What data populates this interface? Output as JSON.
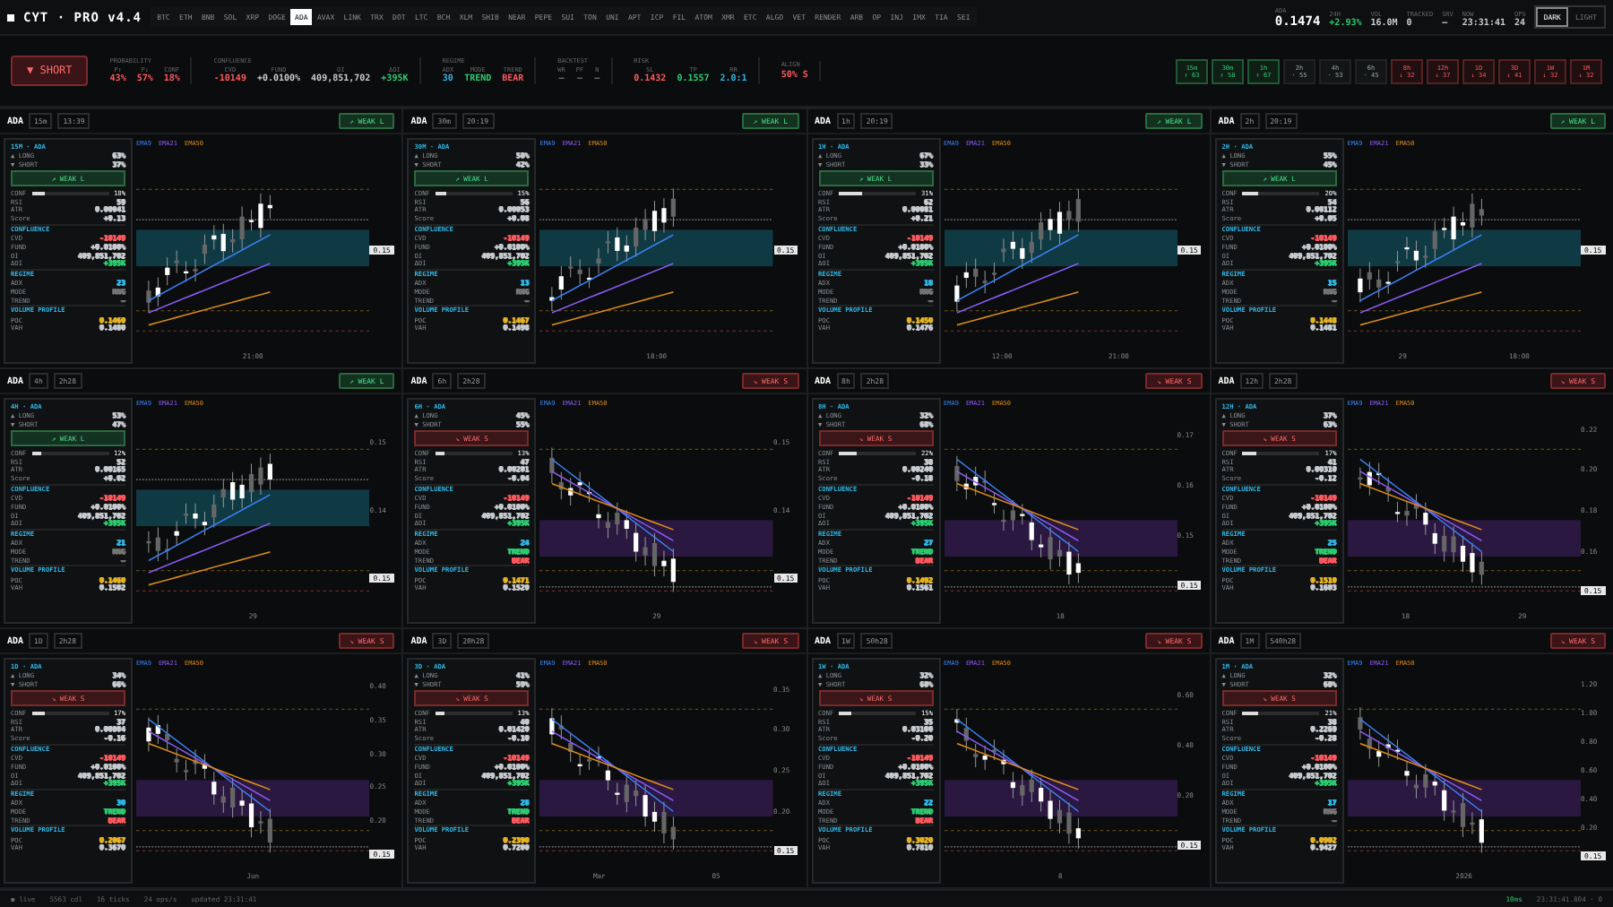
{
  "brand": {
    "title": "CYT · PRO v4.4"
  },
  "tickers": [
    {
      "label": "BTC",
      "selected": false
    },
    {
      "label": "ETH",
      "selected": false
    },
    {
      "label": "BNB",
      "selected": false
    },
    {
      "label": "SOL",
      "selected": false
    },
    {
      "label": "XRP",
      "selected": false
    },
    {
      "label": "DOGE",
      "selected": false
    },
    {
      "label": "ADA",
      "selected": true
    },
    {
      "label": "AVAX",
      "selected": false
    },
    {
      "label": "LINK",
      "selected": false
    },
    {
      "label": "TRX",
      "selected": false
    },
    {
      "label": "DOT",
      "selected": false
    },
    {
      "label": "LTC",
      "selected": false
    },
    {
      "label": "BCH",
      "selected": false
    },
    {
      "label": "XLM",
      "selected": false
    },
    {
      "label": "SHIB",
      "selected": false
    },
    {
      "label": "NEAR",
      "selected": false
    },
    {
      "label": "PEPE",
      "selected": false
    },
    {
      "label": "SUI",
      "selected": false
    },
    {
      "label": "TON",
      "selected": false
    },
    {
      "label": "UNI",
      "selected": false
    },
    {
      "label": "APT",
      "selected": false
    },
    {
      "label": "ICP",
      "selected": false
    },
    {
      "label": "FIL",
      "selected": false
    },
    {
      "label": "ATOM",
      "selected": false
    },
    {
      "label": "XMR",
      "selected": false
    },
    {
      "label": "ETC",
      "selected": false
    },
    {
      "label": "ALGO",
      "selected": false
    },
    {
      "label": "VET",
      "selected": false
    },
    {
      "label": "RENDER",
      "selected": false
    },
    {
      "label": "ARB",
      "selected": false
    },
    {
      "label": "OP",
      "selected": false
    },
    {
      "label": "INJ",
      "selected": false
    },
    {
      "label": "IMX",
      "selected": false
    },
    {
      "label": "TIA",
      "selected": false
    },
    {
      "label": "SEI",
      "selected": false
    }
  ],
  "header_stats": [
    {
      "label": "ADA",
      "value": "0.1474",
      "kind": "price"
    },
    {
      "label": "24H",
      "value": "+2.93%",
      "kind": "up"
    },
    {
      "label": "VOL",
      "value": "16.0M",
      "kind": "plain"
    },
    {
      "label": "TRACKED",
      "value": "0",
      "kind": "plain"
    },
    {
      "label": "SRV",
      "value": "—",
      "kind": "plain"
    },
    {
      "label": "NOW",
      "value": "23:31:41",
      "kind": "plain"
    },
    {
      "label": "OPS",
      "value": "24",
      "kind": "plain"
    }
  ],
  "theme_toggle": [
    {
      "label": "DARK",
      "selected": true
    },
    {
      "label": "LIGHT",
      "selected": false
    }
  ],
  "signal_button": {
    "label": "▼ SHORT"
  },
  "summary_groups": [
    {
      "title": "PROBABILITY",
      "items": [
        {
          "label": "P↑",
          "value": "43%",
          "kind": "down"
        },
        {
          "label": "P↓",
          "value": "57%",
          "kind": "down"
        },
        {
          "label": "CONF",
          "value": "18%",
          "kind": "down"
        }
      ]
    },
    {
      "title": "CONFLUENCE",
      "items": [
        {
          "label": "CVD",
          "value": "-10149",
          "kind": "down"
        },
        {
          "label": "FUND",
          "value": "+0.0100%",
          "kind": "plain"
        },
        {
          "label": "OI",
          "value": "409,851,702",
          "kind": "plain"
        },
        {
          "label": "ΔOI",
          "value": "+395K",
          "kind": "up"
        }
      ]
    },
    {
      "title": "REGIME",
      "items": [
        {
          "label": "ADX",
          "value": "30",
          "kind": "info"
        },
        {
          "label": "MODE",
          "value": "TREND",
          "kind": "up"
        },
        {
          "label": "TREND",
          "value": "BEAR",
          "kind": "down"
        }
      ]
    },
    {
      "title": "BACKTEST",
      "items": [
        {
          "label": "WR",
          "value": "—",
          "kind": "muted"
        },
        {
          "label": "PF",
          "value": "—",
          "kind": "muted"
        },
        {
          "label": "N",
          "value": "—",
          "kind": "muted"
        }
      ]
    },
    {
      "title": "RISK",
      "items": [
        {
          "label": "SL",
          "value": "0.1432",
          "kind": "down"
        },
        {
          "label": "TP",
          "value": "0.1557",
          "kind": "up"
        },
        {
          "label": "RR",
          "value": "2.0:1",
          "kind": "info"
        }
      ]
    },
    {
      "title": "ALIGN",
      "items": [
        {
          "value": "50% S",
          "kind": "down"
        }
      ]
    }
  ],
  "timeframe_chips": [
    {
      "tf": "15m",
      "value": "↑ 63",
      "kind": "up"
    },
    {
      "tf": "30m",
      "value": "↑ 58",
      "kind": "up"
    },
    {
      "tf": "1h",
      "value": "↑ 67",
      "kind": "up"
    },
    {
      "tf": "2h",
      "value": "· 55",
      "kind": "flat"
    },
    {
      "tf": "4h",
      "value": "· 53",
      "kind": "flat"
    },
    {
      "tf": "6h",
      "value": "· 45",
      "kind": "flat"
    },
    {
      "tf": "8h",
      "value": "↓ 32",
      "kind": "down"
    },
    {
      "tf": "12h",
      "value": "↓ 37",
      "kind": "down"
    },
    {
      "tf": "1D",
      "value": "↓ 34",
      "kind": "down"
    },
    {
      "tf": "3D",
      "value": "↓ 41",
      "kind": "down"
    },
    {
      "tf": "1W",
      "value": "↓ 32",
      "kind": "down"
    },
    {
      "tf": "1M",
      "value": "↓ 32",
      "kind": "down"
    }
  ],
  "panels": [
    {
      "symbol": "ADA",
      "tf": "15m",
      "time": "13:39",
      "signal": "↗ WEAK L",
      "bullish": true,
      "legend": [
        "EMA9",
        "EMA21",
        "EMA50"
      ],
      "price_tag": "0.15",
      "x_labels": [
        "21:00"
      ],
      "card": [
        {
          "kind": "title",
          "text": "15M · ADA"
        },
        {
          "kind": "row",
          "label": "▲ LONG",
          "value": "63%"
        },
        {
          "kind": "row",
          "label": "▼ SHORT",
          "value": "37%"
        },
        {
          "kind": "signal",
          "text": "↗ WEAK L"
        },
        {
          "kind": "meter",
          "label": "CONF",
          "value": "18%",
          "level": 0.18
        },
        {
          "kind": "row",
          "label": "RSI",
          "value": "59"
        },
        {
          "kind": "row",
          "label": "ATR",
          "value": "0.00041"
        },
        {
          "kind": "row",
          "label": "Score",
          "value": "+0.13"
        },
        {
          "kind": "section",
          "text": "CONFLUENCE"
        },
        {
          "kind": "row",
          "label": "CVD",
          "value": "-10149",
          "color": "#ff5a5f"
        },
        {
          "kind": "row",
          "label": "FUND",
          "value": "+0.0100%"
        },
        {
          "kind": "row",
          "label": "OI",
          "value": "409,851,702"
        },
        {
          "kind": "row",
          "label": "ΔOI",
          "value": "+395K",
          "color": "#2ecc71"
        },
        {
          "kind": "section",
          "text": "REGIME"
        },
        {
          "kind": "row",
          "label": "ADX",
          "value": "23",
          "color": "#31b6e6"
        },
        {
          "kind": "row",
          "label": "MODE",
          "value": "RNG",
          "color": "#777777"
        },
        {
          "kind": "row",
          "label": "TREND",
          "value": "—",
          "color": "#777777"
        },
        {
          "kind": "section",
          "text": "VOLUME PROFILE"
        },
        {
          "kind": "row",
          "label": "POC",
          "value": "0.1460",
          "color": "#e6b422"
        },
        {
          "kind": "row",
          "label": "VAH",
          "value": "0.1480"
        }
      ]
    },
    {
      "symbol": "ADA",
      "tf": "30m",
      "time": "20:19",
      "signal": "↗ WEAK L",
      "bullish": true,
      "legend": [
        "EMA9",
        "EMA21",
        "EMA50"
      ],
      "price_tag": "0.15",
      "x_labels": [
        "18:00"
      ],
      "card": [
        {
          "kind": "title",
          "text": "30M · ADA"
        },
        {
          "kind": "row",
          "label": "▲ LONG",
          "value": "58%"
        },
        {
          "kind": "row",
          "label": "▼ SHORT",
          "value": "42%"
        },
        {
          "kind": "signal",
          "text": "↗ WEAK L"
        },
        {
          "kind": "meter",
          "label": "CONF",
          "value": "15%",
          "level": 0.15
        },
        {
          "kind": "row",
          "label": "RSI",
          "value": "56"
        },
        {
          "kind": "row",
          "label": "ATR",
          "value": "0.00053"
        },
        {
          "kind": "row",
          "label": "Score",
          "value": "+0.08"
        },
        {
          "kind": "section",
          "text": "CONFLUENCE"
        },
        {
          "kind": "row",
          "label": "CVD",
          "value": "-10149",
          "color": "#ff5a5f"
        },
        {
          "kind": "row",
          "label": "FUND",
          "value": "+0.0100%"
        },
        {
          "kind": "row",
          "label": "OI",
          "value": "409,851,702"
        },
        {
          "kind": "row",
          "label": "ΔOI",
          "value": "+395K",
          "color": "#2ecc71"
        },
        {
          "kind": "section",
          "text": "REGIME"
        },
        {
          "kind": "row",
          "label": "ADX",
          "value": "13",
          "color": "#31b6e6"
        },
        {
          "kind": "row",
          "label": "MODE",
          "value": "RNG",
          "color": "#777777"
        },
        {
          "kind": "row",
          "label": "TREND",
          "value": "—",
          "color": "#777777"
        },
        {
          "kind": "section",
          "text": "VOLUME PROFILE"
        },
        {
          "kind": "row",
          "label": "POC",
          "value": "0.1467",
          "color": "#e6b422"
        },
        {
          "kind": "row",
          "label": "VAH",
          "value": "0.1498"
        }
      ]
    },
    {
      "symbol": "ADA",
      "tf": "1h",
      "time": "20:19",
      "signal": "↗ WEAK L",
      "bullish": true,
      "legend": [
        "EMA9",
        "EMA21",
        "EMA50"
      ],
      "price_tag": "0.15",
      "x_labels": [
        "12:00",
        "21:00"
      ],
      "card": [
        {
          "kind": "title",
          "text": "1H · ADA"
        },
        {
          "kind": "row",
          "label": "▲ LONG",
          "value": "67%"
        },
        {
          "kind": "row",
          "label": "▼ SHORT",
          "value": "33%"
        },
        {
          "kind": "signal",
          "text": "↗ WEAK L"
        },
        {
          "kind": "meter",
          "label": "CONF",
          "value": "31%",
          "level": 0.31
        },
        {
          "kind": "row",
          "label": "RSI",
          "value": "62"
        },
        {
          "kind": "row",
          "label": "ATR",
          "value": "0.00081"
        },
        {
          "kind": "row",
          "label": "Score",
          "value": "+0.21"
        },
        {
          "kind": "section",
          "text": "CONFLUENCE"
        },
        {
          "kind": "row",
          "label": "CVD",
          "value": "-10149",
          "color": "#ff5a5f"
        },
        {
          "kind": "row",
          "label": "FUND",
          "value": "+0.0100%"
        },
        {
          "kind": "row",
          "label": "OI",
          "value": "409,851,702"
        },
        {
          "kind": "row",
          "label": "ΔOI",
          "value": "+395K",
          "color": "#2ecc71"
        },
        {
          "kind": "section",
          "text": "REGIME"
        },
        {
          "kind": "row",
          "label": "ADX",
          "value": "18",
          "color": "#31b6e6"
        },
        {
          "kind": "row",
          "label": "MODE",
          "value": "RNG",
          "color": "#777777"
        },
        {
          "kind": "row",
          "label": "TREND",
          "value": "—",
          "color": "#777777"
        },
        {
          "kind": "section",
          "text": "VOLUME PROFILE"
        },
        {
          "kind": "row",
          "label": "POC",
          "value": "0.1450",
          "color": "#e6b422"
        },
        {
          "kind": "row",
          "label": "VAH",
          "value": "0.1476"
        }
      ]
    },
    {
      "symbol": "ADA",
      "tf": "2h",
      "time": "20:19",
      "signal": "↗ WEAK L",
      "bullish": true,
      "legend": [
        "EMA9",
        "EMA21",
        "EMA50"
      ],
      "price_tag": "0.15",
      "x_labels": [
        "29",
        "18:00"
      ],
      "card": [
        {
          "kind": "title",
          "text": "2H · ADA"
        },
        {
          "kind": "row",
          "label": "▲ LONG",
          "value": "55%"
        },
        {
          "kind": "row",
          "label": "▼ SHORT",
          "value": "45%"
        },
        {
          "kind": "signal",
          "text": "↗ WEAK L"
        },
        {
          "kind": "meter",
          "label": "CONF",
          "value": "20%",
          "level": 0.2
        },
        {
          "kind": "row",
          "label": "RSI",
          "value": "54"
        },
        {
          "kind": "row",
          "label": "ATR",
          "value": "0.00112"
        },
        {
          "kind": "row",
          "label": "Score",
          "value": "+0.05"
        },
        {
          "kind": "section",
          "text": "CONFLUENCE"
        },
        {
          "kind": "row",
          "label": "CVD",
          "value": "-10149",
          "color": "#ff5a5f"
        },
        {
          "kind": "row",
          "label": "FUND",
          "value": "+0.0100%"
        },
        {
          "kind": "row",
          "label": "OI",
          "value": "409,851,702"
        },
        {
          "kind": "row",
          "label": "ΔOI",
          "value": "+395K",
          "color": "#2ecc71"
        },
        {
          "kind": "section",
          "text": "REGIME"
        },
        {
          "kind": "row",
          "label": "ADX",
          "value": "15",
          "color": "#31b6e6"
        },
        {
          "kind": "row",
          "label": "MODE",
          "value": "RNG",
          "color": "#777777"
        },
        {
          "kind": "row",
          "label": "TREND",
          "value": "—",
          "color": "#777777"
        },
        {
          "kind": "section",
          "text": "VOLUME PROFILE"
        },
        {
          "kind": "row",
          "label": "POC",
          "value": "0.1448",
          "color": "#e6b422"
        },
        {
          "kind": "row",
          "label": "VAH",
          "value": "0.1481"
        }
      ]
    },
    {
      "symbol": "ADA",
      "tf": "4h",
      "time": "2h28",
      "signal": "↗ WEAK L",
      "bullish": true,
      "legend": [
        "EMA9",
        "EMA21",
        "EMA50"
      ],
      "price_tag": "0.15",
      "x_labels": [
        "29"
      ],
      "y_labels": [
        "0.15",
        "0.14"
      ],
      "card": [
        {
          "kind": "title",
          "text": "4H · ADA"
        },
        {
          "kind": "row",
          "label": "▲ LONG",
          "value": "53%"
        },
        {
          "kind": "row",
          "label": "▼ SHORT",
          "value": "47%"
        },
        {
          "kind": "signal",
          "text": "↗ WEAK L"
        },
        {
          "kind": "meter",
          "label": "CONF",
          "value": "12%",
          "level": 0.12
        },
        {
          "kind": "row",
          "label": "RSI",
          "value": "52"
        },
        {
          "kind": "row",
          "label": "ATR",
          "value": "0.00165"
        },
        {
          "kind": "row",
          "label": "Score",
          "value": "+0.02"
        },
        {
          "kind": "section",
          "text": "CONFLUENCE"
        },
        {
          "kind": "row",
          "label": "CVD",
          "value": "-10149",
          "color": "#ff5a5f"
        },
        {
          "kind": "row",
          "label": "FUND",
          "value": "+0.0100%"
        },
        {
          "kind": "row",
          "label": "OI",
          "value": "409,851,702"
        },
        {
          "kind": "row",
          "label": "ΔOI",
          "value": "+395K",
          "color": "#2ecc71"
        },
        {
          "kind": "section",
          "text": "REGIME"
        },
        {
          "kind": "row",
          "label": "ADX",
          "value": "21",
          "color": "#31b6e6"
        },
        {
          "kind": "row",
          "label": "MODE",
          "value": "RNG",
          "color": "#777777"
        },
        {
          "kind": "row",
          "label": "TREND",
          "value": "—",
          "color": "#777777"
        },
        {
          "kind": "section",
          "text": "VOLUME PROFILE"
        },
        {
          "kind": "row",
          "label": "POC",
          "value": "0.1460",
          "color": "#e6b422"
        },
        {
          "kind": "row",
          "label": "VAH",
          "value": "0.1502"
        }
      ]
    },
    {
      "symbol": "ADA",
      "tf": "6h",
      "time": "2h28",
      "signal": "↘ WEAK S",
      "bullish": false,
      "legend": [
        "EMA9",
        "EMA21",
        "EMA50"
      ],
      "price_tag": "0.15",
      "x_labels": [
        "29"
      ],
      "y_labels": [
        "0.15",
        "0.14"
      ],
      "card": [
        {
          "kind": "title",
          "text": "6H · ADA"
        },
        {
          "kind": "row",
          "label": "▲ LONG",
          "value": "45%"
        },
        {
          "kind": "row",
          "label": "▼ SHORT",
          "value": "55%"
        },
        {
          "kind": "signal",
          "text": "↘ WEAK S"
        },
        {
          "kind": "meter",
          "label": "CONF",
          "value": "13%",
          "level": 0.13
        },
        {
          "kind": "row",
          "label": "RSI",
          "value": "47"
        },
        {
          "kind": "row",
          "label": "ATR",
          "value": "0.00201"
        },
        {
          "kind": "row",
          "label": "Score",
          "value": "-0.04"
        },
        {
          "kind": "section",
          "text": "CONFLUENCE"
        },
        {
          "kind": "row",
          "label": "CVD",
          "value": "-10149",
          "color": "#ff5a5f"
        },
        {
          "kind": "row",
          "label": "FUND",
          "value": "+0.0100%"
        },
        {
          "kind": "row",
          "label": "OI",
          "value": "409,851,702"
        },
        {
          "kind": "row",
          "label": "ΔOI",
          "value": "+395K",
          "color": "#2ecc71"
        },
        {
          "kind": "section",
          "text": "REGIME"
        },
        {
          "kind": "row",
          "label": "ADX",
          "value": "24",
          "color": "#31b6e6"
        },
        {
          "kind": "row",
          "label": "MODE",
          "value": "TREND",
          "color": "#2ecc71"
        },
        {
          "kind": "row",
          "label": "TREND",
          "value": "BEAR",
          "color": "#ff5a5f"
        },
        {
          "kind": "section",
          "text": "VOLUME PROFILE"
        },
        {
          "kind": "row",
          "label": "POC",
          "value": "0.1471",
          "color": "#e6b422"
        },
        {
          "kind": "row",
          "label": "VAH",
          "value": "0.1520"
        }
      ]
    },
    {
      "symbol": "ADA",
      "tf": "8h",
      "time": "2h28",
      "signal": "↘ WEAK S",
      "bullish": false,
      "legend": [
        "EMA9",
        "EMA21",
        "EMA50"
      ],
      "price_tag": "0.15",
      "x_labels": [
        "18"
      ],
      "y_labels": [
        "0.17",
        "0.16",
        "0.15"
      ],
      "card": [
        {
          "kind": "title",
          "text": "8H · ADA"
        },
        {
          "kind": "row",
          "label": "▲ LONG",
          "value": "32%"
        },
        {
          "kind": "row",
          "label": "▼ SHORT",
          "value": "68%"
        },
        {
          "kind": "signal",
          "text": "↘ WEAK S"
        },
        {
          "kind": "meter",
          "label": "CONF",
          "value": "22%",
          "level": 0.22
        },
        {
          "kind": "row",
          "label": "RSI",
          "value": "38"
        },
        {
          "kind": "row",
          "label": "ATR",
          "value": "0.00240"
        },
        {
          "kind": "row",
          "label": "Score",
          "value": "-0.18"
        },
        {
          "kind": "section",
          "text": "CONFLUENCE"
        },
        {
          "kind": "row",
          "label": "CVD",
          "value": "-10149",
          "color": "#ff5a5f"
        },
        {
          "kind": "row",
          "label": "FUND",
          "value": "+0.0100%"
        },
        {
          "kind": "row",
          "label": "OI",
          "value": "409,851,702"
        },
        {
          "kind": "row",
          "label": "ΔOI",
          "value": "+395K",
          "color": "#2ecc71"
        },
        {
          "kind": "section",
          "text": "REGIME"
        },
        {
          "kind": "row",
          "label": "ADX",
          "value": "27",
          "color": "#31b6e6"
        },
        {
          "kind": "row",
          "label": "MODE",
          "value": "TREND",
          "color": "#2ecc71"
        },
        {
          "kind": "row",
          "label": "TREND",
          "value": "BEAR",
          "color": "#ff5a5f"
        },
        {
          "kind": "section",
          "text": "VOLUME PROFILE"
        },
        {
          "kind": "row",
          "label": "POC",
          "value": "0.1492",
          "color": "#e6b422"
        },
        {
          "kind": "row",
          "label": "VAH",
          "value": "0.1561"
        }
      ]
    },
    {
      "symbol": "ADA",
      "tf": "12h",
      "time": "2h28",
      "signal": "↘ WEAK S",
      "bullish": false,
      "legend": [
        "EMA9",
        "EMA21",
        "EMA50"
      ],
      "price_tag": "0.15",
      "x_labels": [
        "18",
        "29"
      ],
      "y_labels": [
        "0.22",
        "0.20",
        "0.18",
        "0.16"
      ],
      "card": [
        {
          "kind": "title",
          "text": "12H · ADA"
        },
        {
          "kind": "row",
          "label": "▲ LONG",
          "value": "37%"
        },
        {
          "kind": "row",
          "label": "▼ SHORT",
          "value": "63%"
        },
        {
          "kind": "signal",
          "text": "↘ WEAK S"
        },
        {
          "kind": "meter",
          "label": "CONF",
          "value": "17%",
          "level": 0.17
        },
        {
          "kind": "row",
          "label": "RSI",
          "value": "41"
        },
        {
          "kind": "row",
          "label": "ATR",
          "value": "0.00310"
        },
        {
          "kind": "row",
          "label": "Score",
          "value": "-0.12"
        },
        {
          "kind": "section",
          "text": "CONFLUENCE"
        },
        {
          "kind": "row",
          "label": "CVD",
          "value": "-10149",
          "color": "#ff5a5f"
        },
        {
          "kind": "row",
          "label": "FUND",
          "value": "+0.0100%"
        },
        {
          "kind": "row",
          "label": "OI",
          "value": "409,851,702"
        },
        {
          "kind": "row",
          "label": "ΔOI",
          "value": "+395K",
          "color": "#2ecc71"
        },
        {
          "kind": "section",
          "text": "REGIME"
        },
        {
          "kind": "row",
          "label": "ADX",
          "value": "25",
          "color": "#31b6e6"
        },
        {
          "kind": "row",
          "label": "MODE",
          "value": "TREND",
          "color": "#2ecc71"
        },
        {
          "kind": "row",
          "label": "TREND",
          "value": "BEAR",
          "color": "#ff5a5f"
        },
        {
          "kind": "section",
          "text": "VOLUME PROFILE"
        },
        {
          "kind": "row",
          "label": "POC",
          "value": "0.1510",
          "color": "#e6b422"
        },
        {
          "kind": "row",
          "label": "VAH",
          "value": "0.1603"
        }
      ]
    },
    {
      "symbol": "ADA",
      "tf": "1D",
      "time": "2h28",
      "signal": "↘ WEAK S",
      "bullish": false,
      "legend": [
        "EMA9",
        "EMA21",
        "EMA50"
      ],
      "price_tag": "0.15",
      "x_labels": [
        "Jun"
      ],
      "y_labels": [
        "0.40",
        "0.35",
        "0.30",
        "0.25",
        "0.20"
      ],
      "card": [
        {
          "kind": "title",
          "text": "1D · ADA"
        },
        {
          "kind": "row",
          "label": "▲ LONG",
          "value": "34%"
        },
        {
          "kind": "row",
          "label": "▼ SHORT",
          "value": "66%"
        },
        {
          "kind": "signal",
          "text": "↘ WEAK S"
        },
        {
          "kind": "meter",
          "label": "CONF",
          "value": "17%",
          "level": 0.17
        },
        {
          "kind": "row",
          "label": "RSI",
          "value": "37"
        },
        {
          "kind": "row",
          "label": "ATR",
          "value": "0.00804"
        },
        {
          "kind": "row",
          "label": "Score",
          "value": "-0.16"
        },
        {
          "kind": "section",
          "text": "CONFLUENCE"
        },
        {
          "kind": "row",
          "label": "CVD",
          "value": "-10149",
          "color": "#ff5a5f"
        },
        {
          "kind": "row",
          "label": "FUND",
          "value": "+0.0100%"
        },
        {
          "kind": "row",
          "label": "OI",
          "value": "409,851,702"
        },
        {
          "kind": "row",
          "label": "ΔOI",
          "value": "+395K",
          "color": "#2ecc71"
        },
        {
          "kind": "section",
          "text": "REGIME"
        },
        {
          "kind": "row",
          "label": "ADX",
          "value": "30",
          "color": "#31b6e6"
        },
        {
          "kind": "row",
          "label": "MODE",
          "value": "TREND",
          "color": "#2ecc71"
        },
        {
          "kind": "row",
          "label": "TREND",
          "value": "BEAR",
          "color": "#ff5a5f"
        },
        {
          "kind": "section",
          "text": "VOLUME PROFILE"
        },
        {
          "kind": "row",
          "label": "POC",
          "value": "0.2067",
          "color": "#e6b422"
        },
        {
          "kind": "row",
          "label": "VAH",
          "value": "0.3670"
        }
      ]
    },
    {
      "symbol": "ADA",
      "tf": "3D",
      "time": "20h28",
      "signal": "↘ WEAK S",
      "bullish": false,
      "legend": [
        "EMA9",
        "EMA21",
        "EMA50"
      ],
      "price_tag": "0.15",
      "x_labels": [
        "Mar",
        "05"
      ],
      "y_labels": [
        "0.35",
        "0.30",
        "0.25",
        "0.20"
      ],
      "card": [
        {
          "kind": "title",
          "text": "3D · ADA"
        },
        {
          "kind": "row",
          "label": "▲ LONG",
          "value": "41%"
        },
        {
          "kind": "row",
          "label": "▼ SHORT",
          "value": "59%"
        },
        {
          "kind": "signal",
          "text": "↘ WEAK S"
        },
        {
          "kind": "meter",
          "label": "CONF",
          "value": "13%",
          "level": 0.13
        },
        {
          "kind": "row",
          "label": "RSI",
          "value": "40"
        },
        {
          "kind": "row",
          "label": "ATR",
          "value": "0.01420"
        },
        {
          "kind": "row",
          "label": "Score",
          "value": "-0.10"
        },
        {
          "kind": "section",
          "text": "CONFLUENCE"
        },
        {
          "kind": "row",
          "label": "CVD",
          "value": "-10149",
          "color": "#ff5a5f"
        },
        {
          "kind": "row",
          "label": "FUND",
          "value": "+0.0100%"
        },
        {
          "kind": "row",
          "label": "OI",
          "value": "409,851,702"
        },
        {
          "kind": "row",
          "label": "ΔOI",
          "value": "+395K",
          "color": "#2ecc71"
        },
        {
          "kind": "section",
          "text": "REGIME"
        },
        {
          "kind": "row",
          "label": "ADX",
          "value": "28",
          "color": "#31b6e6"
        },
        {
          "kind": "row",
          "label": "MODE",
          "value": "TREND",
          "color": "#2ecc71"
        },
        {
          "kind": "row",
          "label": "TREND",
          "value": "BEAR",
          "color": "#ff5a5f"
        },
        {
          "kind": "section",
          "text": "VOLUME PROFILE"
        },
        {
          "kind": "row",
          "label": "POC",
          "value": "0.2390",
          "color": "#e6b422"
        },
        {
          "kind": "row",
          "label": "VAH",
          "value": "0.7200"
        }
      ]
    },
    {
      "symbol": "ADA",
      "tf": "1W",
      "time": "50h28",
      "signal": "↘ WEAK S",
      "bullish": false,
      "legend": [
        "EMA9",
        "EMA21",
        "EMA50"
      ],
      "price_tag": "0.15",
      "x_labels": [
        "8"
      ],
      "y_labels": [
        "0.60",
        "0.40",
        "0.20"
      ],
      "card": [
        {
          "kind": "title",
          "text": "1W · ADA"
        },
        {
          "kind": "row",
          "label": "▲ LONG",
          "value": "32%"
        },
        {
          "kind": "row",
          "label": "▼ SHORT",
          "value": "68%"
        },
        {
          "kind": "signal",
          "text": "↘ WEAK S"
        },
        {
          "kind": "meter",
          "label": "CONF",
          "value": "15%",
          "level": 0.15
        },
        {
          "kind": "row",
          "label": "RSI",
          "value": "35"
        },
        {
          "kind": "row",
          "label": "ATR",
          "value": "0.03100"
        },
        {
          "kind": "row",
          "label": "Score",
          "value": "-0.20"
        },
        {
          "kind": "section",
          "text": "CONFLUENCE"
        },
        {
          "kind": "row",
          "label": "CVD",
          "value": "-10149",
          "color": "#ff5a5f"
        },
        {
          "kind": "row",
          "label": "FUND",
          "value": "+0.0100%"
        },
        {
          "kind": "row",
          "label": "OI",
          "value": "409,851,702"
        },
        {
          "kind": "row",
          "label": "ΔOI",
          "value": "+395K",
          "color": "#2ecc71"
        },
        {
          "kind": "section",
          "text": "REGIME"
        },
        {
          "kind": "row",
          "label": "ADX",
          "value": "22",
          "color": "#31b6e6"
        },
        {
          "kind": "row",
          "label": "MODE",
          "value": "TREND",
          "color": "#2ecc71"
        },
        {
          "kind": "row",
          "label": "TREND",
          "value": "BEAR",
          "color": "#ff5a5f"
        },
        {
          "kind": "section",
          "text": "VOLUME PROFILE"
        },
        {
          "kind": "row",
          "label": "POC",
          "value": "0.3020",
          "color": "#e6b422"
        },
        {
          "kind": "row",
          "label": "VAH",
          "value": "0.7810"
        }
      ]
    },
    {
      "symbol": "ADA",
      "tf": "1M",
      "time": "540h28",
      "signal": "↘ WEAK S",
      "bullish": false,
      "legend": [
        "EMA9",
        "EMA21",
        "EMA50"
      ],
      "price_tag": "0.15",
      "x_labels": [
        "2026"
      ],
      "y_labels": [
        "1.20",
        "1.00",
        "0.80",
        "0.60",
        "0.40",
        "0.20"
      ],
      "card": [
        {
          "kind": "title",
          "text": "1M · ADA"
        },
        {
          "kind": "row",
          "label": "▲ LONG",
          "value": "32%"
        },
        {
          "kind": "row",
          "label": "▼ SHORT",
          "value": "68%"
        },
        {
          "kind": "signal",
          "text": "↘ WEAK S"
        },
        {
          "kind": "meter",
          "label": "CONF",
          "value": "21%",
          "level": 0.21
        },
        {
          "kind": "row",
          "label": "RSI",
          "value": "38"
        },
        {
          "kind": "row",
          "label": "ATR",
          "value": "0.2269"
        },
        {
          "kind": "row",
          "label": "Score",
          "value": "-0.28"
        },
        {
          "kind": "section",
          "text": "CONFLUENCE"
        },
        {
          "kind": "row",
          "label": "CVD",
          "value": "-10149",
          "color": "#ff5a5f"
        },
        {
          "kind": "row",
          "label": "FUND",
          "value": "+0.0100%"
        },
        {
          "kind": "row",
          "label": "OI",
          "value": "409,851,702"
        },
        {
          "kind": "row",
          "label": "ΔOI",
          "value": "+395K",
          "color": "#2ecc71"
        },
        {
          "kind": "section",
          "text": "REGIME"
        },
        {
          "kind": "row",
          "label": "ADX",
          "value": "17",
          "color": "#31b6e6"
        },
        {
          "kind": "row",
          "label": "MODE",
          "value": "RNG",
          "color": "#777777"
        },
        {
          "kind": "row",
          "label": "TREND",
          "value": "—",
          "color": "#777777"
        },
        {
          "kind": "section",
          "text": "VOLUME PROFILE"
        },
        {
          "kind": "row",
          "label": "POC",
          "value": "0.0902",
          "color": "#e6b422"
        },
        {
          "kind": "row",
          "label": "VAH",
          "value": "0.9427"
        }
      ]
    }
  ],
  "footer": {
    "items": [
      "● live",
      "5563 cdl",
      "16 ticks",
      "24 ops/s",
      "updated 23:31:41"
    ],
    "latency": "10ms",
    "clock": "23:31:41.804 · 0"
  }
}
